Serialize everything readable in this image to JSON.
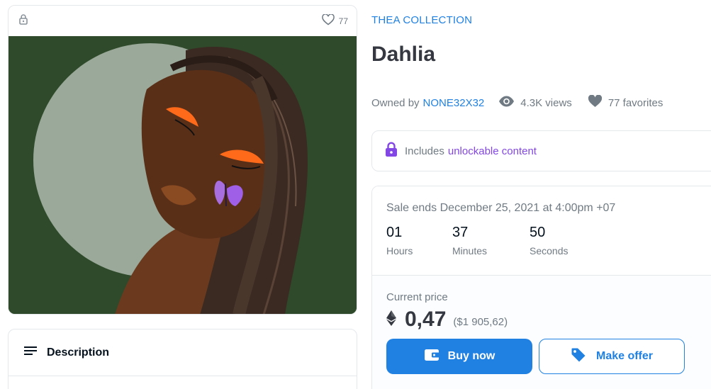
{
  "item": {
    "favorites_count": "77",
    "collection": "THEA COLLECTION",
    "title": "Dahlia",
    "owned_by_label": "Owned by",
    "owner": "NONE32X32",
    "views": "4.3K views",
    "favorites": "77 favorites"
  },
  "unlockable": {
    "prefix": "Includes",
    "link": "unlockable content"
  },
  "sale": {
    "ends": "Sale ends December 25, 2021 at 4:00pm +07",
    "countdown": [
      {
        "value": "01",
        "label": "Hours"
      },
      {
        "value": "37",
        "label": "Minutes"
      },
      {
        "value": "50",
        "label": "Seconds"
      }
    ],
    "current_price_label": "Current price",
    "price": "0,47",
    "price_usd": "($1 905,62)",
    "buy_label": "Buy now",
    "offer_label": "Make offer"
  },
  "description": {
    "heading": "Description"
  },
  "colors": {
    "accent": "#2081e2",
    "unlockable": "#8247e5",
    "art_background": "#2f4a2a"
  }
}
